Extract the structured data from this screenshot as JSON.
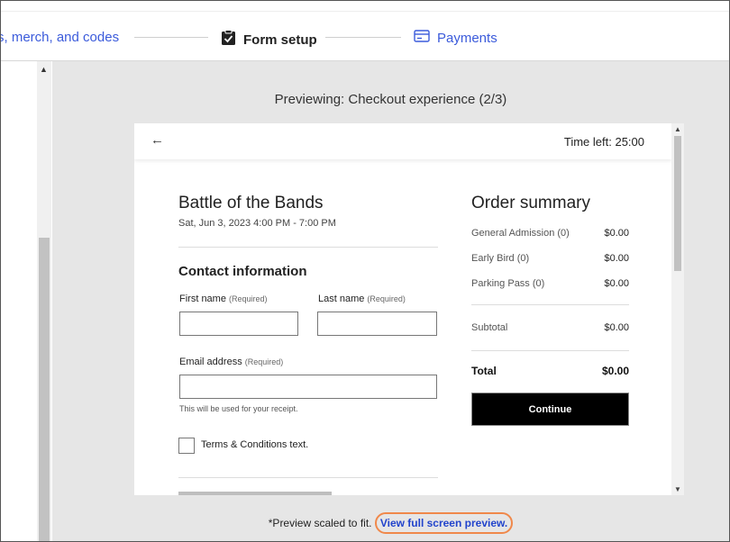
{
  "stepper": {
    "prev_label": "s, merch, and codes",
    "current_label": "Form setup",
    "next_label": "Payments"
  },
  "preview": {
    "title": "Previewing: Checkout experience (2/3)",
    "footnote_text": "*Preview scaled to fit.",
    "full_screen_link": "View full screen preview."
  },
  "checkout": {
    "back_icon": "arrow-left-icon",
    "time_left": "Time left: 25:00",
    "event_title": "Battle of the Bands",
    "event_date": "Sat, Jun 3, 2023 4:00 PM - 7:00 PM",
    "contact_title": "Contact information",
    "first_name_label": "First name",
    "last_name_label": "Last name",
    "email_label": "Email address",
    "required_tag": "(Required)",
    "email_hint": "This will be used for your receipt.",
    "terms_label": "Terms & Conditions text.",
    "first_name_value": "",
    "last_name_value": "",
    "email_value": ""
  },
  "summary": {
    "title": "Order summary",
    "items": [
      {
        "label": "General Admission (0)",
        "amount": "$0.00"
      },
      {
        "label": "Early Bird (0)",
        "amount": "$0.00"
      },
      {
        "label": "Parking Pass (0)",
        "amount": "$0.00"
      }
    ],
    "subtotal_label": "Subtotal",
    "subtotal_amount": "$0.00",
    "total_label": "Total",
    "total_amount": "$0.00",
    "continue_label": "Continue"
  },
  "colors": {
    "link_blue": "#3b5bdb",
    "highlight_orange": "#f0884a",
    "button_black": "#000000"
  }
}
